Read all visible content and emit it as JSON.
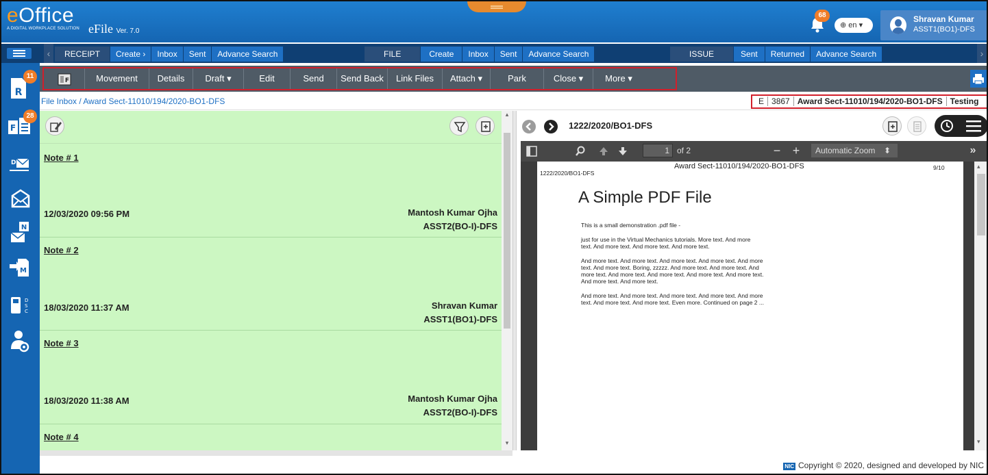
{
  "header": {
    "logo": "eOffice",
    "logo_tagline": "A DIGITAL WORKPLACE SOLUTION",
    "product": "eFile",
    "version": "Ver. 7.0",
    "notification_count": "68",
    "language": "en",
    "user_name": "Shravan Kumar",
    "user_role": "ASST1(BO1)-DFS"
  },
  "nav": {
    "receipt": {
      "label": "RECEIPT",
      "items": [
        "Create ›",
        "Inbox",
        "Sent",
        "Advance Search"
      ]
    },
    "file": {
      "label": "FILE",
      "items": [
        "Create",
        "Inbox",
        "Sent",
        "Advance Search"
      ]
    },
    "issue": {
      "label": "ISSUE",
      "items": [
        "Sent",
        "Returned",
        "Advance Search"
      ]
    }
  },
  "toolbar": [
    "Movement",
    "Details",
    "Draft ▾",
    "Edit",
    "Send",
    "Send Back",
    "Link Files",
    "Attach ▾",
    "Park",
    "Close ▾",
    "More ▾"
  ],
  "sidebar_badges": {
    "receipts": "11",
    "files": "28"
  },
  "breadcrumb": {
    "root": "File Inbox",
    "current": "Award Sect-11010/194/2020-BO1-DFS"
  },
  "file_info": {
    "type": "E",
    "number": "3867",
    "file_name": "Award Sect-11010/194/2020-BO1-DFS",
    "subject": "Testing"
  },
  "notes": [
    {
      "title": "Note # 1",
      "date": "12/03/2020 09:56 PM",
      "author": "Mantosh Kumar Ojha",
      "designation": "ASST2(BO-I)-DFS"
    },
    {
      "title": "Note # 2",
      "date": "18/03/2020 11:37 AM",
      "author": "Shravan Kumar",
      "designation": "ASST1(BO1)-DFS"
    },
    {
      "title": "Note # 3",
      "date": "18/03/2020 11:38 AM",
      "author": "Mantosh Kumar Ojha",
      "designation": "ASST2(BO-I)-DFS"
    },
    {
      "title": "Note # 4"
    }
  ],
  "viewer": {
    "doc_id": "1222/2020/BO1-DFS",
    "page_input": "1",
    "page_total": "of 2",
    "zoom": "Automatic Zoom",
    "page_header_left": "1222/2020/BO1-DFS",
    "page_header_center": "Award Sect-11010/194/2020-BO1-DFS",
    "page_header_right": "9/10",
    "pdf_title": "A Simple PDF File",
    "para1": "This is a small demonstration .pdf file -",
    "para2a": "just for use in the Virtual Mechanics tutorials. More text. And more",
    "para2b": "text. And more text. And more text. And more text.",
    "para3a": "And more text. And more text. And more text. And more text. And more",
    "para3b": "text. And more text. Boring, zzzzz. And more text. And more text. And",
    "para3c": "more text. And more text. And more text. And more text. And more text.",
    "para3d": "And more text. And more text.",
    "para4a": "And more text. And more text. And more text. And more text. And more",
    "para4b": "text. And more text. And more text. Even more. Continued on page 2 ..."
  },
  "footer": {
    "nic": "NIC",
    "copyright": "Copyright © 2020, designed and developed by NIC"
  },
  "colors": {
    "header": "#1565b2",
    "accent": "#1e70c4",
    "notes_bg": "#ccf7c2",
    "toolbar": "#4f5b66",
    "highlight_border": "#d21f2b",
    "badge": "#f07d28"
  }
}
